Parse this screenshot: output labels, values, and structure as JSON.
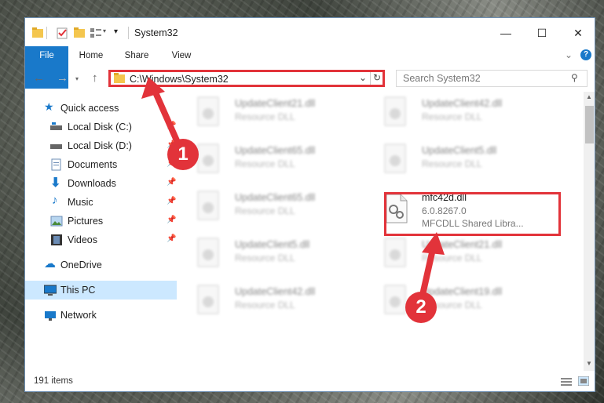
{
  "window": {
    "title": "System32",
    "minimize": "—",
    "maximize": "☐",
    "close": "✕"
  },
  "ribbon": {
    "tabs": [
      "File",
      "Home",
      "Share",
      "View"
    ]
  },
  "address": {
    "path": "C:\\Windows\\System32",
    "search_placeholder": "Search System32"
  },
  "sidebar": {
    "items": [
      {
        "label": "Quick access"
      },
      {
        "label": "Local Disk (C:)"
      },
      {
        "label": "Local Disk (D:)"
      },
      {
        "label": "Documents"
      },
      {
        "label": "Downloads"
      },
      {
        "label": "Music"
      },
      {
        "label": "Pictures"
      },
      {
        "label": "Videos"
      },
      {
        "label": "OneDrive"
      },
      {
        "label": "This PC"
      },
      {
        "label": "Network"
      }
    ]
  },
  "files": [
    {
      "name": "UpdateClient21.dll",
      "type": "Resource DLL"
    },
    {
      "name": "UpdateClient42.dll",
      "type": "Resource DLL"
    },
    {
      "name": "UpdateClient65.dll",
      "type": "Resource DLL"
    },
    {
      "name": "UpdateClient5.dll",
      "type": "Resource DLL"
    },
    {
      "name": "UpdateClient65.dll",
      "type": "Resource DLL"
    },
    {
      "name": "mfc42d.dll",
      "version": "6.0.8267.0",
      "type": "MFCDLL Shared Libra..."
    },
    {
      "name": "UpdateClient5.dll",
      "type": "Resource DLL"
    },
    {
      "name": "UpdateClient21.dll",
      "type": "Resource DLL"
    },
    {
      "name": "UpdateClient42.dll",
      "type": "Resource DLL"
    },
    {
      "name": "UpdateClient19.dll",
      "type": "Resource DLL"
    }
  ],
  "status": {
    "count": "191 items"
  },
  "callouts": [
    "1",
    "2"
  ],
  "colors": {
    "accent": "#1979ca",
    "highlight": "#e2333a",
    "selection": "#cce8ff"
  }
}
